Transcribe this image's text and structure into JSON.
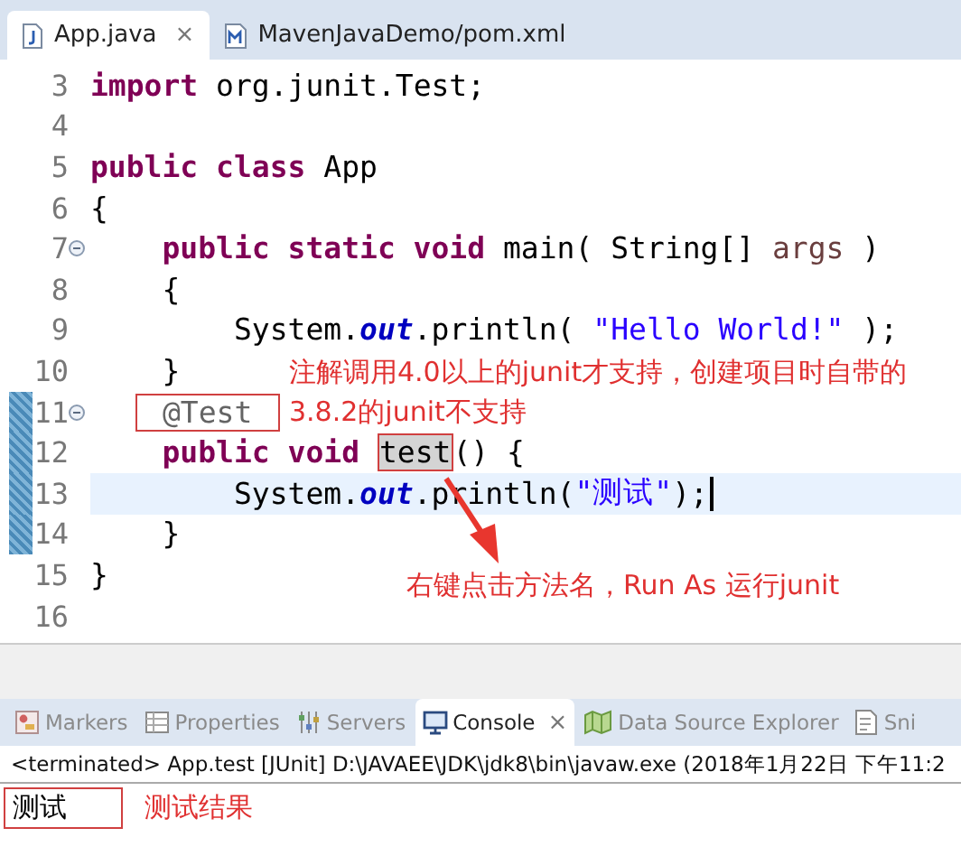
{
  "editor_tabs": [
    {
      "label": "App.java",
      "kind": "java",
      "selected": true,
      "close": "⨯"
    },
    {
      "label": "MavenJavaDemo/pom.xml",
      "kind": "maven",
      "selected": false
    }
  ],
  "code_lines": [
    {
      "number": "3",
      "changed": false,
      "fold": false,
      "current": false,
      "tokens": [
        {
          "kind": "kw",
          "t": "import "
        },
        {
          "kind": "plain",
          "t": "org.junit.Test;"
        }
      ]
    },
    {
      "number": "4",
      "changed": false,
      "fold": false,
      "current": false
    },
    {
      "number": "5",
      "changed": false,
      "fold": false,
      "current": false,
      "tokens": [
        {
          "kind": "kw",
          "t": "public class "
        },
        {
          "kind": "plain",
          "t": "App"
        }
      ]
    },
    {
      "number": "6",
      "changed": false,
      "fold": false,
      "current": false,
      "tokens": [
        {
          "kind": "plain",
          "t": "{"
        }
      ]
    },
    {
      "number": "7",
      "changed": false,
      "fold": true,
      "current": false,
      "tokens": [
        {
          "kind": "kw",
          "t": "    public static void "
        },
        {
          "kind": "plain",
          "t": "main( String[] "
        },
        {
          "kind": "param",
          "t": "args"
        },
        {
          "kind": "plain",
          "t": " )"
        }
      ]
    },
    {
      "number": "8",
      "changed": false,
      "fold": false,
      "current": false,
      "tokens": [
        {
          "kind": "plain",
          "t": "    {"
        }
      ]
    },
    {
      "number": "9",
      "changed": false,
      "fold": false,
      "current": false,
      "tokens": [
        {
          "kind": "plain",
          "t": "        System."
        },
        {
          "kind": "field",
          "t": "out"
        },
        {
          "kind": "plain",
          "t": ".println( "
        },
        {
          "kind": "string",
          "t": "\"Hello World!\""
        },
        {
          "kind": "plain",
          "t": " );"
        }
      ]
    },
    {
      "number": "10",
      "changed": false,
      "fold": false,
      "current": false,
      "tokens": [
        {
          "kind": "plain",
          "t": "    }"
        }
      ]
    },
    {
      "number": "11",
      "changed": true,
      "fold": true,
      "current": false,
      "tokens": [
        {
          "kind": "annotation",
          "t": "@Test",
          "boxed": true
        }
      ]
    },
    {
      "number": "12",
      "changed": true,
      "fold": false,
      "current": false,
      "tokens": [
        {
          "kind": "kw",
          "t": "    public void "
        },
        {
          "kind": "occurrence",
          "t": "test",
          "boxed": true
        },
        {
          "kind": "plain",
          "t": "() {"
        }
      ]
    },
    {
      "number": "13",
      "changed": true,
      "fold": false,
      "current": true,
      "tokens": [
        {
          "kind": "plain",
          "t": "        System."
        },
        {
          "kind": "field",
          "t": "out"
        },
        {
          "kind": "plain",
          "t": ".println("
        },
        {
          "kind": "string",
          "t": "\"测试\""
        },
        {
          "kind": "plain",
          "t": ");"
        }
      ]
    },
    {
      "number": "14",
      "changed": true,
      "fold": false,
      "current": false,
      "tokens": [
        {
          "kind": "plain",
          "t": "    }"
        }
      ]
    },
    {
      "number": "15",
      "changed": false,
      "fold": false,
      "current": false,
      "tokens": [
        {
          "kind": "plain",
          "t": "}"
        }
      ]
    },
    {
      "number": "16",
      "changed": false,
      "fold": false,
      "current": false
    }
  ],
  "notes": [
    "注解调用4.0以上的junit才支持，创建项目时自带的3.8.2的junit不支持",
    "右键点击方法名，Run As 运行junit"
  ],
  "view_tabs": [
    {
      "label": "Markers",
      "kind": "markers",
      "selected": false
    },
    {
      "label": "Properties",
      "kind": "properties",
      "selected": false
    },
    {
      "label": "Servers",
      "kind": "servers",
      "selected": false
    },
    {
      "label": "Console",
      "kind": "console",
      "selected": true,
      "close": "⨯"
    },
    {
      "label": "Data Source Explorer",
      "kind": "datasource",
      "selected": false
    },
    {
      "label": "Sni",
      "kind": "snippets",
      "selected": false
    }
  ],
  "console": {
    "header": "<terminated> App.test [JUnit] D:\\JAVAEE\\JDK\\jdk8\\bin\\javaw.exe (2018年1月22日 下午11:2",
    "output": "测试",
    "note": "测试结果"
  }
}
